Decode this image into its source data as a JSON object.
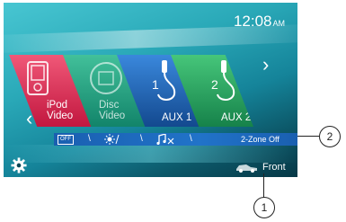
{
  "status": {
    "clock": "12:08",
    "ampm": "AM"
  },
  "sources": [
    {
      "line1": "iPod",
      "line2": "Video"
    },
    {
      "line1": "Disc",
      "line2": "Video"
    },
    {
      "line1": "AUX 1",
      "line2": "",
      "badge": "1"
    },
    {
      "line1": "AUX 2",
      "line2": "",
      "badge": "2"
    }
  ],
  "setting_bar": {
    "off_badge": "OFF",
    "zone_label": "2-Zone Off",
    "icons": [
      "power-off-icon",
      "dimmer-icon",
      "mute-icon"
    ]
  },
  "footer": {
    "fader_label": "Front"
  },
  "callouts": {
    "one": "1",
    "two": "2"
  },
  "colors": {
    "ipod_tile": "#d42a52",
    "disc_tile": "#1f9c7e",
    "aux1_tile": "#1f64b8",
    "aux2_tile": "#26a05d",
    "setting_bar": "#1f68bf"
  }
}
